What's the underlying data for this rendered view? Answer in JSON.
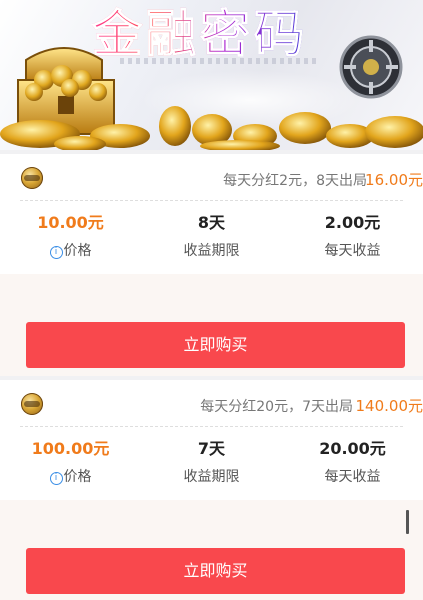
{
  "banner": {
    "title": "金融密码",
    "icons": [
      "treasure-chest-icon",
      "safe-icon",
      "gold-coins-icon"
    ]
  },
  "products": [
    {
      "icon": "gold-coin-icon",
      "description": "每天分红2元，8天出局",
      "headline_price": "16.00元",
      "price_value": "10.00元",
      "price_label": "价格",
      "term_value": "8天",
      "term_label": "收益期限",
      "daily_value": "2.00元",
      "daily_label": "每天收益",
      "buy_label": "立即购买"
    },
    {
      "icon": "gold-coin-icon",
      "description": "每天分红20元，7天出局",
      "headline_price": "140.00元",
      "price_value": "100.00元",
      "price_label": "价格",
      "term_value": "7天",
      "term_label": "收益期限",
      "daily_value": "20.00元",
      "daily_label": "每天收益",
      "buy_label": "立即购买"
    }
  ],
  "colors": {
    "accent_orange": "#f07b1b",
    "button_red": "#f9484d",
    "info_blue": "#3a8ee6"
  }
}
